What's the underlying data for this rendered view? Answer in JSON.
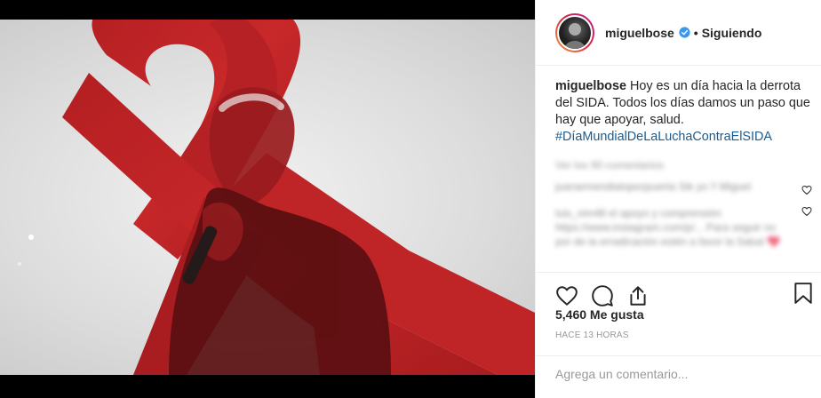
{
  "post": {
    "username": "miguelbose",
    "verified_icon": "verified-badge-icon",
    "dot": "•",
    "follow_status": "Siguiendo",
    "caption_user": "miguelbose",
    "caption_text": "Hoy es un día hacia la derrota del SIDA. Todos los días damos un paso que hay que apoyar, salud.",
    "hashtag": "#DíaMundialDeLaLuchaContraElSIDA",
    "view_all": "Ver los 90 comentarios",
    "comments": [
      {
        "text": "juanarmendialopezpuerta Sik yo !! Miguel",
        "blurred": true
      },
      {
        "text": "luis_vim48 el apoyo y comprensión https://www.instagram.com/p/... Para seguir no por de la erradicación estén a favor la Salud 💖",
        "blurred": true
      }
    ],
    "likes": "5,460 Me gusta",
    "time": "HACE 13 HORAS",
    "add_comment_placeholder": "Agrega un comentario..."
  },
  "colors": {
    "ribbon": "#c62627",
    "link": "#1c5b8c",
    "text": "#262626",
    "muted": "#999999"
  }
}
